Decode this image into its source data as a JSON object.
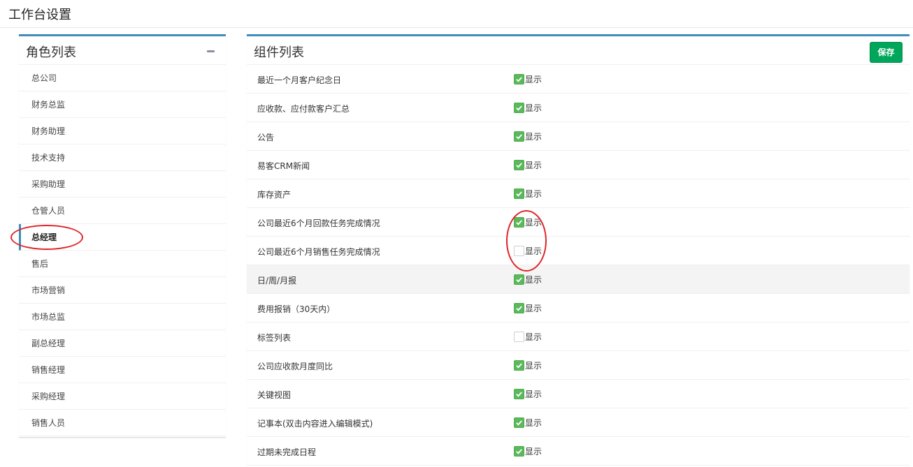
{
  "page": {
    "title": "工作台设置"
  },
  "roles": {
    "title": "角色列表",
    "active_index": 6,
    "items": [
      "总公司",
      "财务总监",
      "财务助理",
      "技术支持",
      "采购助理",
      "仓管人员",
      "总经理",
      "售后",
      "市场营销",
      "市场总监",
      "副总经理",
      "销售经理",
      "采购经理",
      "销售人员"
    ]
  },
  "widgets": {
    "title": "组件列表",
    "save_label": "保存",
    "show_label": "显示",
    "highlight_index": 7,
    "items": [
      {
        "name": "最近一个月客户纪念日",
        "checked": true
      },
      {
        "name": "应收款、应付款客户汇总",
        "checked": true
      },
      {
        "name": "公告",
        "checked": true
      },
      {
        "name": "易客CRM新闻",
        "checked": true
      },
      {
        "name": "库存资产",
        "checked": true
      },
      {
        "name": "公司最近6个月回款任务完成情况",
        "checked": true
      },
      {
        "name": "公司最近6个月销售任务完成情况",
        "checked": false
      },
      {
        "name": "日/周/月报",
        "checked": true
      },
      {
        "name": "费用报销（30天内）",
        "checked": true
      },
      {
        "name": "标签列表",
        "checked": false
      },
      {
        "name": "公司应收款月度同比",
        "checked": true
      },
      {
        "name": "关键视图",
        "checked": true
      },
      {
        "name": "记事本(双击内容进入编辑模式)",
        "checked": true
      },
      {
        "name": "过期未完成日程",
        "checked": true
      }
    ]
  },
  "colors": {
    "panel_accent": "#3c8dbc",
    "checkbox_checked": "#5cb85c",
    "save_button": "#00a65a",
    "annotation": "#e0252a"
  }
}
